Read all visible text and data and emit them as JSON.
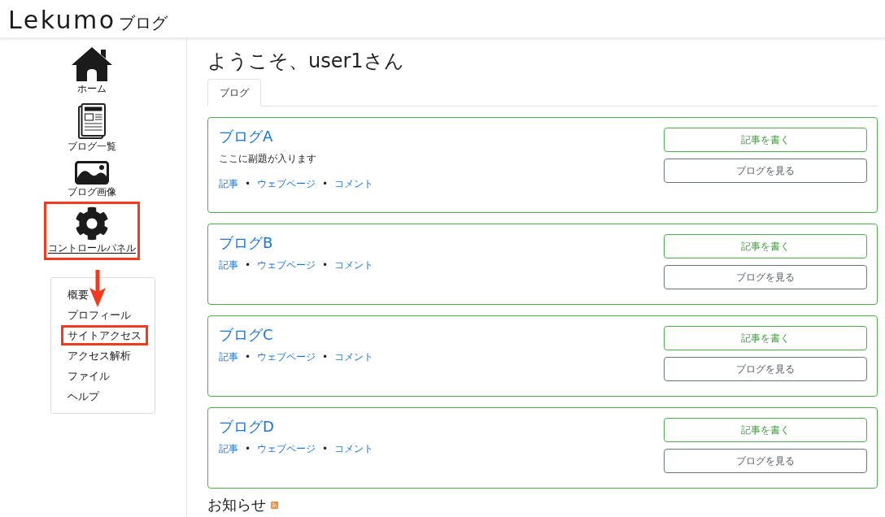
{
  "header": {
    "logo": "Lekumo",
    "logo_suffix": "ブログ"
  },
  "sidebar": {
    "nav": [
      {
        "kind": "home",
        "label": "ホーム",
        "selected": false,
        "highlighted": false
      },
      {
        "kind": "blogs",
        "label": "ブログ一覧",
        "selected": false,
        "highlighted": false
      },
      {
        "kind": "images",
        "label": "ブログ画像",
        "selected": false,
        "highlighted": false
      },
      {
        "kind": "control",
        "label": "コントロールパネル",
        "selected": true,
        "highlighted": true,
        "submenu": [
          {
            "label": "概要",
            "highlighted": false
          },
          {
            "label": "プロフィール",
            "highlighted": false
          },
          {
            "label": "サイトアクセス",
            "highlighted": true
          },
          {
            "label": "アクセス解析",
            "highlighted": false
          },
          {
            "label": "ファイル",
            "highlighted": false
          },
          {
            "label": "ヘルプ",
            "highlighted": false
          }
        ]
      }
    ],
    "callout_arrow": true
  },
  "main": {
    "heading": "ようこそ、user1さん",
    "tabs": [
      {
        "label": "ブログ",
        "selected": true
      }
    ],
    "blogs": [
      {
        "title": "ブログA",
        "subtitle": "ここに副題が入ります",
        "meta": [
          {
            "kind": "link",
            "text": "記事"
          },
          {
            "kind": "separator",
            "text": "•"
          },
          {
            "kind": "link",
            "text": "ウェブページ"
          },
          {
            "kind": "separator",
            "text": "•"
          },
          {
            "kind": "link",
            "text": "コメント"
          }
        ],
        "buttons": [
          {
            "kind": "primary",
            "label": "記事を書く"
          },
          {
            "kind": "secondary",
            "label": "ブログを見る"
          }
        ]
      },
      {
        "title": "ブログB",
        "meta": [
          {
            "kind": "link",
            "text": "記事"
          },
          {
            "kind": "separator",
            "text": "•"
          },
          {
            "kind": "link",
            "text": "ウェブページ"
          },
          {
            "kind": "separator",
            "text": "•"
          },
          {
            "kind": "link",
            "text": "コメント"
          }
        ],
        "buttons": [
          {
            "kind": "primary",
            "label": "記事を書く"
          },
          {
            "kind": "secondary",
            "label": "ブログを見る"
          }
        ]
      },
      {
        "title": "ブログC",
        "meta": [
          {
            "kind": "link",
            "text": "記事"
          },
          {
            "kind": "separator",
            "text": "•"
          },
          {
            "kind": "link",
            "text": "ウェブページ"
          },
          {
            "kind": "separator",
            "text": "•"
          },
          {
            "kind": "link",
            "text": "コメント"
          }
        ],
        "buttons": [
          {
            "kind": "primary",
            "label": "記事を書く"
          },
          {
            "kind": "secondary",
            "label": "ブログを見る"
          }
        ]
      },
      {
        "title": "ブログD",
        "meta": [
          {
            "kind": "link",
            "text": "記事"
          },
          {
            "kind": "separator",
            "text": "•"
          },
          {
            "kind": "link",
            "text": "ウェブページ"
          },
          {
            "kind": "separator",
            "text": "•"
          },
          {
            "kind": "link",
            "text": "コメント"
          }
        ],
        "buttons": [
          {
            "kind": "primary",
            "label": "記事を書く"
          },
          {
            "kind": "secondary",
            "label": "ブログを見る"
          }
        ]
      }
    ],
    "news": {
      "title": "お知らせ"
    }
  }
}
